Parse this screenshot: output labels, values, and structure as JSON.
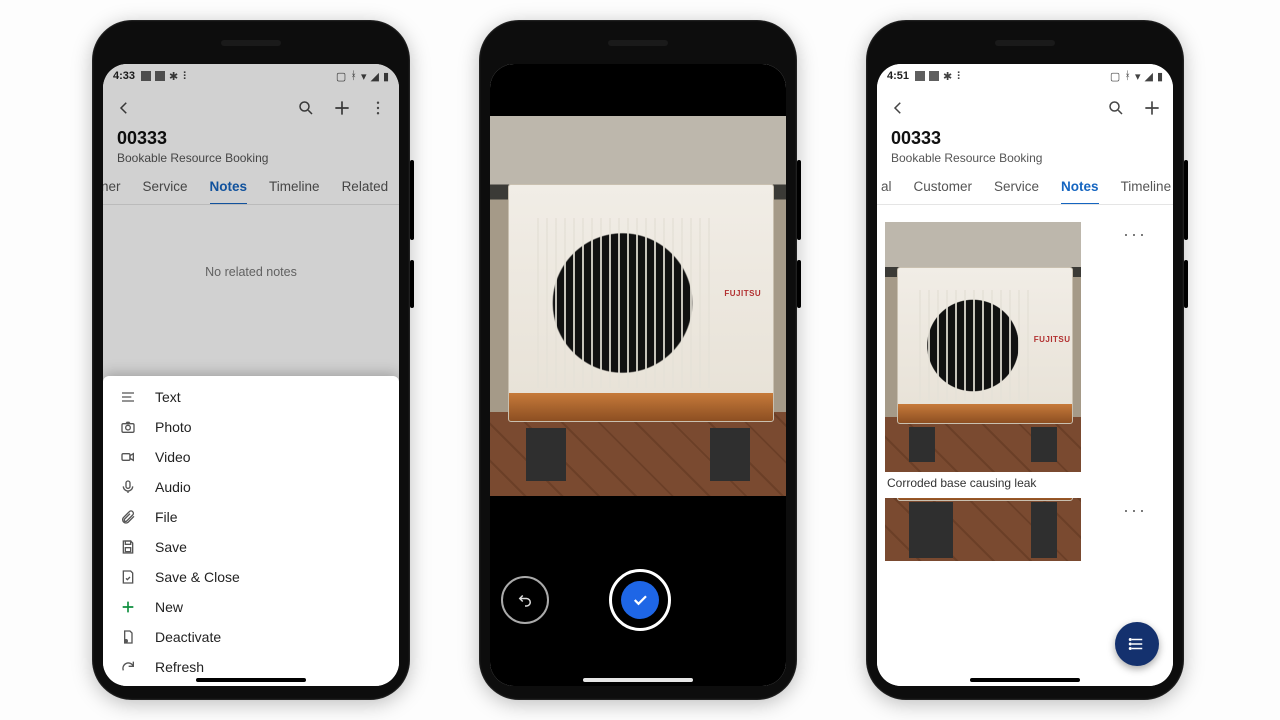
{
  "phone1": {
    "time": "4:33",
    "record_id": "00333",
    "subtitle": "Bookable Resource Booking",
    "tabs": [
      "ner",
      "Service",
      "Notes",
      "Timeline",
      "Related"
    ],
    "active_tab": "Notes",
    "empty_text": "No related notes",
    "actions": {
      "text": "Text",
      "photo": "Photo",
      "video": "Video",
      "audio": "Audio",
      "file": "File",
      "save": "Save",
      "save_close": "Save & Close",
      "new": "New",
      "deactivate": "Deactivate",
      "refresh": "Refresh"
    }
  },
  "phone2": {
    "brand_label": "FUJITSU"
  },
  "phone3": {
    "time": "4:51",
    "record_id": "00333",
    "subtitle": "Bookable Resource Booking",
    "tabs": [
      "al",
      "Customer",
      "Service",
      "Notes",
      "Timeline"
    ],
    "active_tab": "Notes",
    "note1_caption": "Corroded base causing leak"
  },
  "icons": {
    "back": "back-icon",
    "search": "search-icon",
    "plus": "plus-icon",
    "more": "more-vert-icon",
    "fab": "list-icon"
  }
}
